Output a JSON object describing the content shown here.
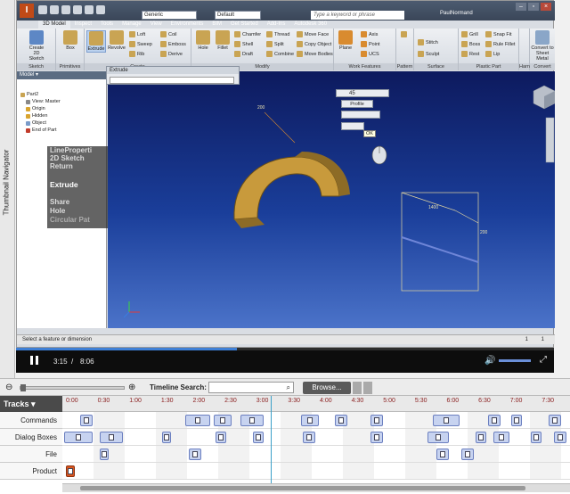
{
  "thumbnail_navigator": {
    "label": "Thumbnail Navigator"
  },
  "app": {
    "title": "I",
    "style_combo": "Generic",
    "appearance_combo": "Default",
    "search_placeholder": "Type a keyword or phrase",
    "user": "PaulNormand",
    "window_buttons": [
      "–",
      "▫",
      "×"
    ],
    "tabs": [
      "3D Model",
      "Inspect",
      "Tools",
      "Manage",
      "View",
      "Environments",
      "BIM",
      "Get Started",
      "Add-Ins",
      "Autodesk 360"
    ],
    "ribbon": {
      "groups": [
        "Sketch",
        "Primitives",
        "Create",
        "Modify",
        "Work Features",
        "Pattern",
        "Surface",
        "Plastic Part",
        "Harness",
        "Convert"
      ],
      "sketch": [
        "Create",
        "2D Sketch"
      ],
      "primitives": "Box",
      "create_big": [
        "Extrude",
        "Revolve"
      ],
      "create_small": [
        "Loft",
        "Sweep",
        "Rib",
        "Coil",
        "Emboss",
        "Derive"
      ],
      "modify_big": [
        "Hole",
        "Fillet"
      ],
      "modify_small": [
        "Chamfer",
        "Shell",
        "Draft",
        "Thread",
        "Split",
        "Combine",
        "Move Face",
        "Copy Object",
        "Move Bodies"
      ],
      "work_big": "Plane",
      "work_small": [
        "Axis",
        "Point",
        "UCS"
      ],
      "surface": [
        "Stitch",
        "Sculpt"
      ],
      "plastic": [
        "Grill",
        "Boss",
        "Rest",
        "Snap Fit",
        "Rule Fillet",
        "Lip"
      ],
      "convert": [
        "Convert to",
        "Sheet Metal"
      ]
    },
    "browser": {
      "header": "Model",
      "items": [
        "Part2",
        "View: Master",
        "Origin",
        "Hidden",
        "Object",
        "End of Part"
      ]
    },
    "extrude_panel": {
      "title": "Extrude"
    },
    "thumb_overlay": [
      "LineProperti",
      "2D Sketch",
      "Return",
      "Extrude",
      "Share",
      "Hole",
      "Circular Pat"
    ],
    "mini_toolbar": {
      "distance": "45",
      "button1": "Profile",
      "ok": "OK"
    },
    "dimensions": [
      "200",
      "1400",
      "200"
    ],
    "status": {
      "text": "Select a feature or dimension",
      "n1": "1",
      "n2": "1"
    },
    "colors": {
      "part_fill": "#c89a3c",
      "viewport_top": "#0d1a5e",
      "viewport_bottom": "#4b73c9",
      "accent": "#3e7fd6"
    }
  },
  "video": {
    "current": "3:15",
    "separator": "/",
    "total": "8:06",
    "progress": 0.41
  },
  "timeline": {
    "search_label": "Timeline Search:",
    "browse_label": "Browse...",
    "tracks_header": "Tracks",
    "track_names": [
      "Commands",
      "Dialog Boxes",
      "File",
      "Product"
    ],
    "ticks": [
      "0:00",
      "0:30",
      "1:00",
      "1:30",
      "2:00",
      "2:30",
      "3:00",
      "3:30",
      "4:00",
      "4:30",
      "5:00",
      "5:30",
      "6:00",
      "6:30",
      "7:00",
      "7:30"
    ],
    "playhead": 0.41
  }
}
